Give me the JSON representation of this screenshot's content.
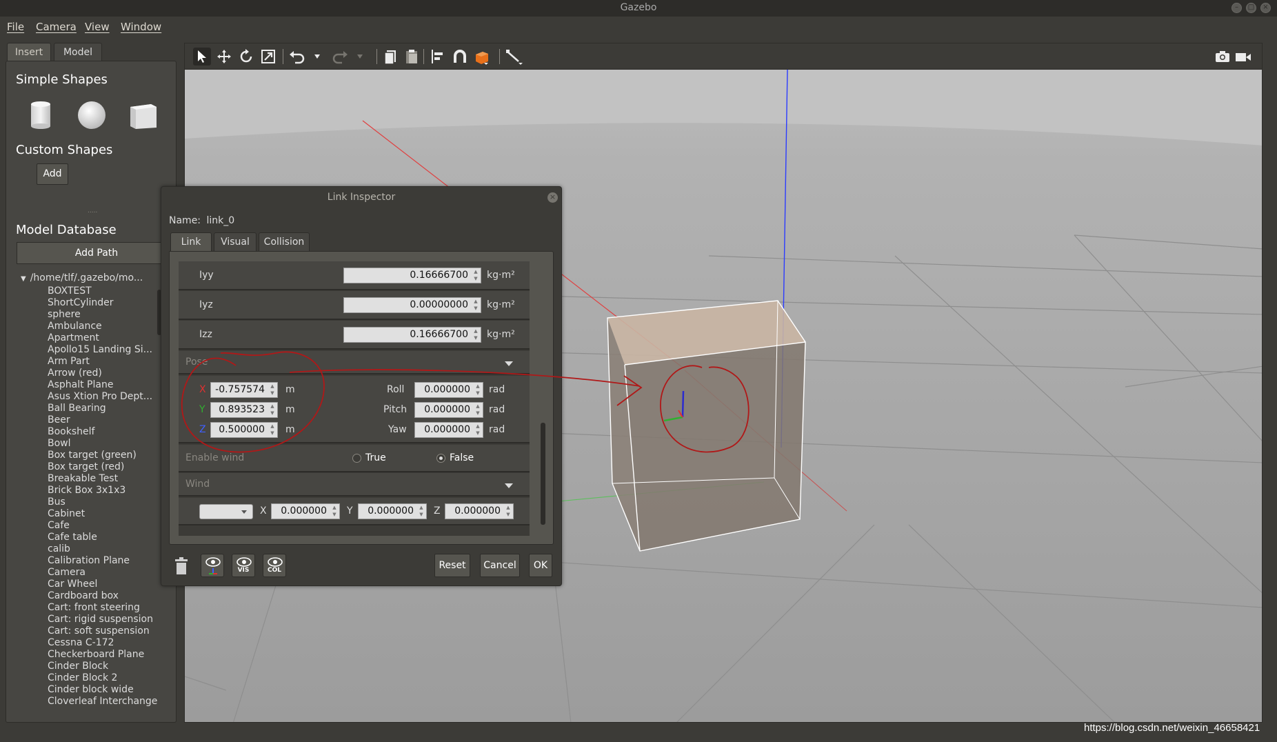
{
  "window": {
    "title": "Gazebo"
  },
  "menu": [
    "File",
    "Camera",
    "View",
    "Window"
  ],
  "left_panel": {
    "tabs": [
      "Insert",
      "Model"
    ],
    "simple_shapes_title": "Simple Shapes",
    "custom_shapes_title": "Custom Shapes",
    "add_label": "Add",
    "splitter": ".....",
    "model_db_title": "Model Database",
    "add_path_label": "Add Path",
    "tree_root": "/home/tlf/.gazebo/mo...",
    "models": [
      "BOXTEST",
      "ShortCylinder",
      "sphere",
      "Ambulance",
      "Apartment",
      "Apollo15 Landing Si...",
      "Arm Part",
      "Arrow (red)",
      "Asphalt Plane",
      "Asus Xtion Pro Dept...",
      "Ball Bearing",
      "Beer",
      "Bookshelf",
      "Bowl",
      "Box target (green)",
      "Box target (red)",
      "Breakable Test",
      "Brick Box 3x1x3",
      "Bus",
      "Cabinet",
      "Cafe",
      "Cafe table",
      "calib",
      "Calibration Plane",
      "Camera",
      "Car Wheel",
      "Cardboard box",
      "Cart: front steering",
      "Cart: rigid suspension",
      "Cart: soft suspension",
      "Cessna C-172",
      "Checkerboard Plane",
      "Cinder Block",
      "Cinder Block 2",
      "Cinder block wide",
      "Cloverleaf Interchange"
    ]
  },
  "toolbar": {
    "icons": [
      "select-icon",
      "translate-icon",
      "rotate-icon",
      "scale-icon",
      "undo-icon",
      "undo-dropdown-icon",
      "redo-icon",
      "redo-dropdown-icon",
      "copy-icon",
      "paste-icon",
      "align-icon",
      "snap-icon",
      "view-angle-icon",
      "measure-icon",
      "screenshot-icon",
      "record-icon"
    ]
  },
  "dialog": {
    "title": "Link Inspector",
    "name_label": "Name:",
    "name_value": "link_0",
    "tabs": [
      "Link",
      "Visual",
      "Collision"
    ],
    "inertia": [
      {
        "label": "Iyy",
        "value": "0.16666700",
        "unit": "kg·m²"
      },
      {
        "label": "Iyz",
        "value": "0.00000000",
        "unit": "kg·m²"
      },
      {
        "label": "Izz",
        "value": "0.16666700",
        "unit": "kg·m²"
      }
    ],
    "pose_label": "Pose",
    "pose": {
      "x": {
        "label": "X",
        "value": "-0.757574",
        "unit": "m"
      },
      "y": {
        "label": "Y",
        "value": "0.893523",
        "unit": "m"
      },
      "z": {
        "label": "Z",
        "value": "0.500000",
        "unit": "m"
      },
      "roll": {
        "label": "Roll",
        "value": "0.000000",
        "unit": "rad"
      },
      "pitch": {
        "label": "Pitch",
        "value": "0.000000",
        "unit": "rad"
      },
      "yaw": {
        "label": "Yaw",
        "value": "0.000000",
        "unit": "rad"
      }
    },
    "enable_wind": {
      "label": "Enable wind",
      "true_label": "True",
      "false_label": "False",
      "selected": "False"
    },
    "wind_label": "Wind",
    "wind": {
      "x": {
        "label": "X",
        "value": "0.000000"
      },
      "y": {
        "label": "Y",
        "value": "0.000000"
      },
      "z": {
        "label": "Z",
        "value": "0.000000"
      }
    },
    "eye_buttons": [
      "",
      "VIS",
      "COL"
    ],
    "buttons": {
      "reset": "Reset",
      "cancel": "Cancel",
      "ok": "OK"
    }
  },
  "colors": {
    "x_axis": "#e03030",
    "y_axis": "#30b030",
    "z_axis": "#3040e0",
    "annotation": "#b01818"
  },
  "watermark": "https://blog.csdn.net/weixin_46658421"
}
